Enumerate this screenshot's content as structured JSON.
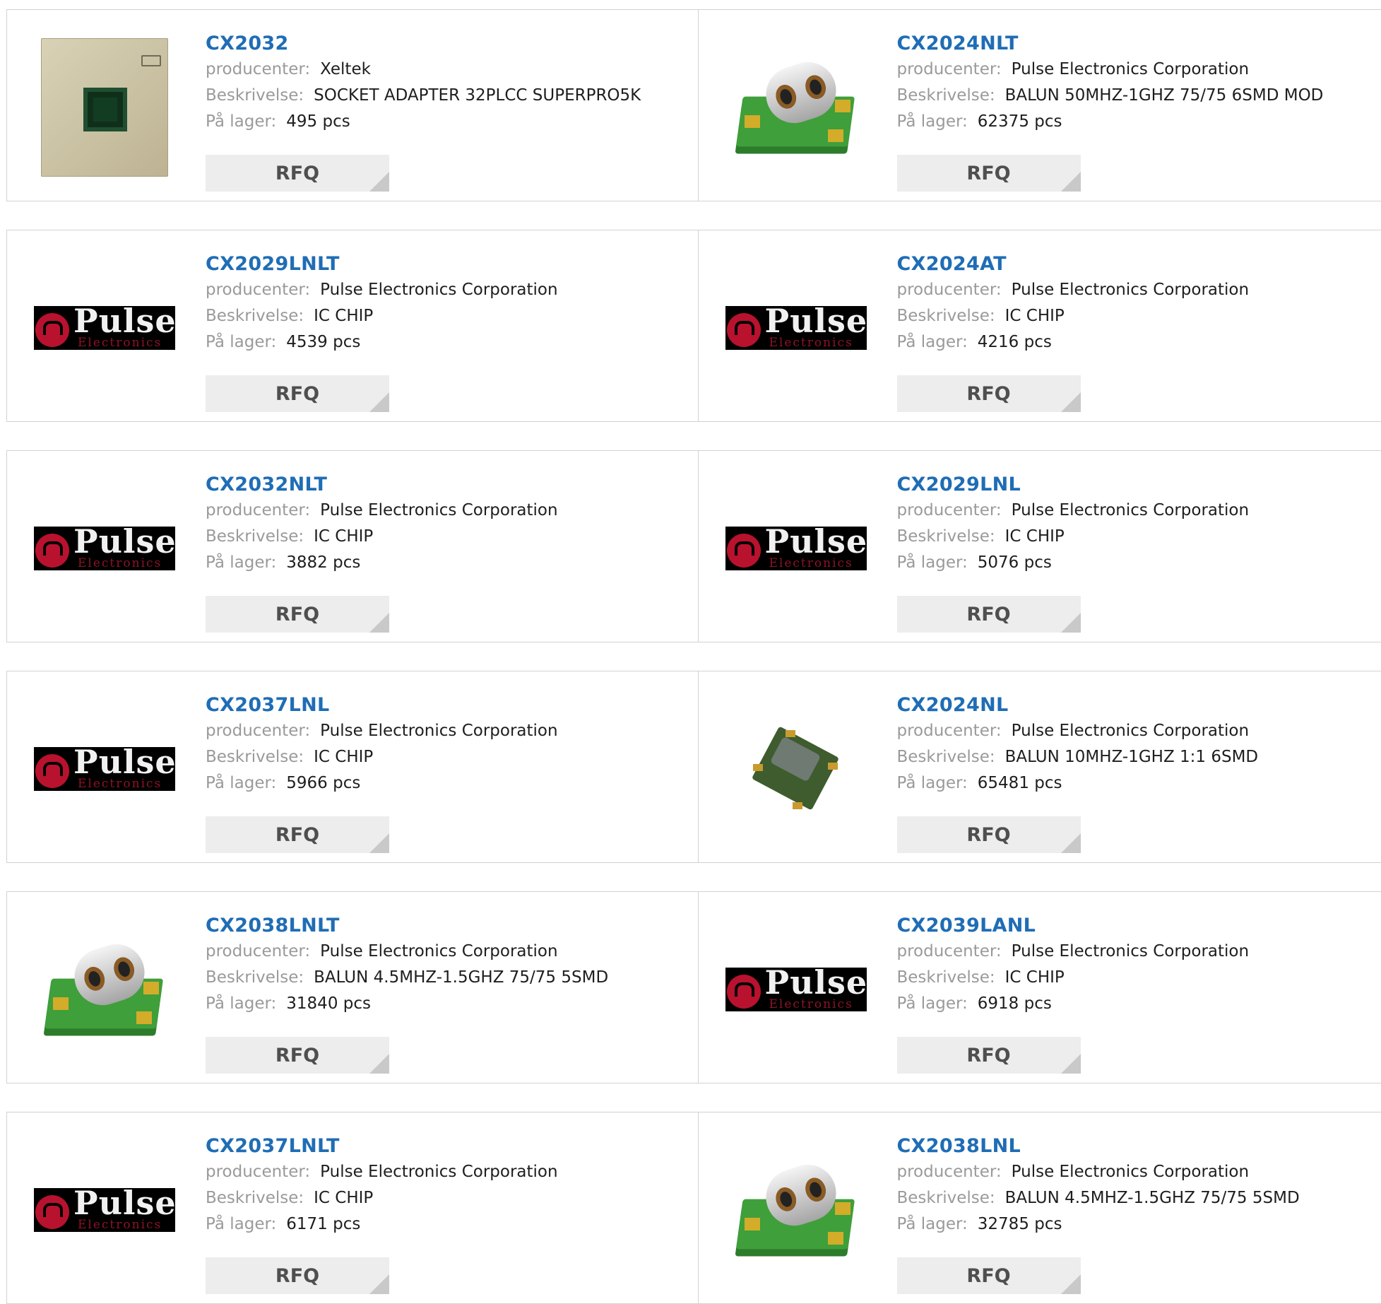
{
  "labels": {
    "producer": "producenter:",
    "description": "Beskrivelse:",
    "stock": "På lager:",
    "rfq": "RFQ"
  },
  "products": [
    {
      "name": "CX2032",
      "producer": "Xeltek",
      "description": "SOCKET ADAPTER 32PLCC SUPERPRO5K",
      "stock": "495 pcs",
      "image": "chip-adapter"
    },
    {
      "name": "CX2024NLT",
      "producer": "Pulse Electronics Corporation",
      "description": "BALUN 50MHZ-1GHZ 75/75 6SMD MOD",
      "stock": "62375 pcs",
      "image": "balun-transformer"
    },
    {
      "name": "CX2029LNLT",
      "producer": "Pulse Electronics Corporation",
      "description": "IC CHIP",
      "stock": "4539 pcs",
      "image": "pulse-logo"
    },
    {
      "name": "CX2024AT",
      "producer": "Pulse Electronics Corporation",
      "description": "IC CHIP",
      "stock": "4216 pcs",
      "image": "pulse-logo"
    },
    {
      "name": "CX2032NLT",
      "producer": "Pulse Electronics Corporation",
      "description": "IC CHIP",
      "stock": "3882 pcs",
      "image": "pulse-logo"
    },
    {
      "name": "CX2029LNL",
      "producer": "Pulse Electronics Corporation",
      "description": "IC CHIP",
      "stock": "5076 pcs",
      "image": "pulse-logo"
    },
    {
      "name": "CX2037LNL",
      "producer": "Pulse Electronics Corporation",
      "description": "IC CHIP",
      "stock": "5966 pcs",
      "image": "pulse-logo"
    },
    {
      "name": "CX2024NL",
      "producer": "Pulse Electronics Corporation",
      "description": "BALUN 10MHZ-1GHZ 1:1 6SMD",
      "stock": "65481 pcs",
      "image": "small-balun"
    },
    {
      "name": "CX2038LNLT",
      "producer": "Pulse Electronics Corporation",
      "description": "BALUN 4.5MHZ-1.5GHZ 75/75 5SMD",
      "stock": "31840 pcs",
      "image": "balun-transformer"
    },
    {
      "name": "CX2039LANL",
      "producer": "Pulse Electronics Corporation",
      "description": "IC CHIP",
      "stock": "6918 pcs",
      "image": "pulse-logo"
    },
    {
      "name": "CX2037LNLT",
      "producer": "Pulse Electronics Corporation",
      "description": "IC CHIP",
      "stock": "6171 pcs",
      "image": "pulse-logo"
    },
    {
      "name": "CX2038LNL",
      "producer": "Pulse Electronics Corporation",
      "description": "BALUN 4.5MHZ-1.5GHZ 75/75 5SMD",
      "stock": "32785 pcs",
      "image": "balun-transformer"
    }
  ],
  "logo": {
    "word": "Pulse",
    "sub": "Electronics"
  },
  "colors": {
    "link": "#1f6db5",
    "label": "#9a9a9a",
    "button_bg": "#ededed",
    "logo_red": "#b8122e"
  }
}
